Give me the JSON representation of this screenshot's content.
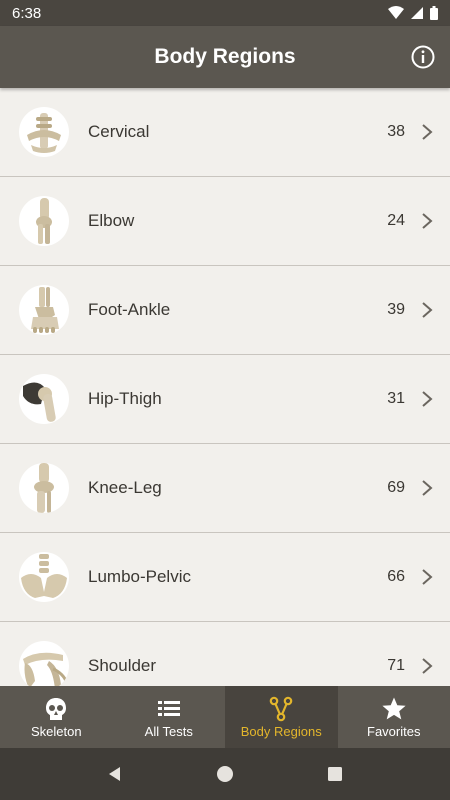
{
  "status_bar": {
    "time": "6:38"
  },
  "app_bar": {
    "title": "Body Regions",
    "info_icon": "info-icon"
  },
  "regions": [
    {
      "label": "Cervical",
      "count": "38",
      "icon": "cervical-spine-icon"
    },
    {
      "label": "Elbow",
      "count": "24",
      "icon": "elbow-icon"
    },
    {
      "label": "Foot-Ankle",
      "count": "39",
      "icon": "foot-ankle-icon"
    },
    {
      "label": "Hip-Thigh",
      "count": "31",
      "icon": "hip-thigh-icon"
    },
    {
      "label": "Knee-Leg",
      "count": "69",
      "icon": "knee-leg-icon"
    },
    {
      "label": "Lumbo-Pelvic",
      "count": "66",
      "icon": "lumbo-pelvic-icon"
    },
    {
      "label": "Shoulder",
      "count": "71",
      "icon": "shoulder-icon"
    }
  ],
  "bottom_nav": {
    "items": [
      {
        "label": "Skeleton",
        "icon": "skull-icon"
      },
      {
        "label": "All Tests",
        "icon": "list-icon"
      },
      {
        "label": "Body Regions",
        "icon": "body-regions-icon",
        "active": true
      },
      {
        "label": "Favorites",
        "icon": "star-icon"
      }
    ],
    "active_color": "#e3b62c"
  },
  "colors": {
    "app_bar": "#5b5750",
    "background": "#f2f0ec",
    "accent": "#e3b62c"
  }
}
